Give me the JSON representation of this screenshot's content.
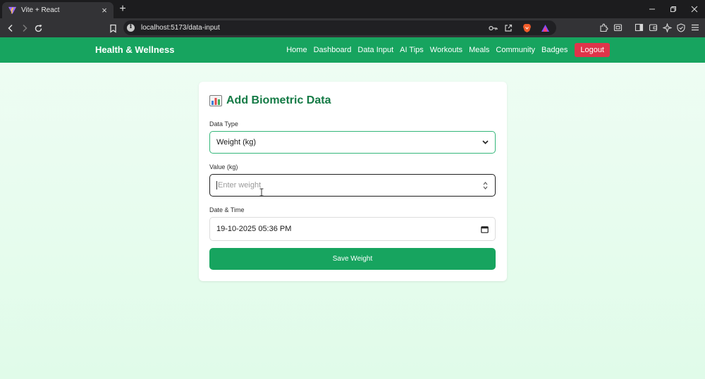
{
  "browser": {
    "tab_title": "Vite + React",
    "tab_close": "×",
    "new_tab": "+",
    "url": "localhost:5173/data-input",
    "window_controls": [
      "minimize",
      "restore",
      "close"
    ]
  },
  "navbar": {
    "brand": "Health & Wellness",
    "links": [
      "Home",
      "Dashboard",
      "Data Input",
      "AI Tips",
      "Workouts",
      "Meals",
      "Community",
      "Badges"
    ],
    "logout": "Logout"
  },
  "form": {
    "title": "Add Biometric Data",
    "title_icon": "bar-chart-icon",
    "data_type_label": "Data Type",
    "data_type_value": "Weight (kg)",
    "value_label": "Value (kg)",
    "value_placeholder": "Enter weight",
    "datetime_label": "Date & Time",
    "datetime_value": "19-10-2025 05:36 PM",
    "save_button": "Save Weight"
  },
  "colors": {
    "brand_green": "#17a45f",
    "title_green": "#147a45",
    "logout_red": "#e0344a",
    "background": "#effdf4"
  }
}
